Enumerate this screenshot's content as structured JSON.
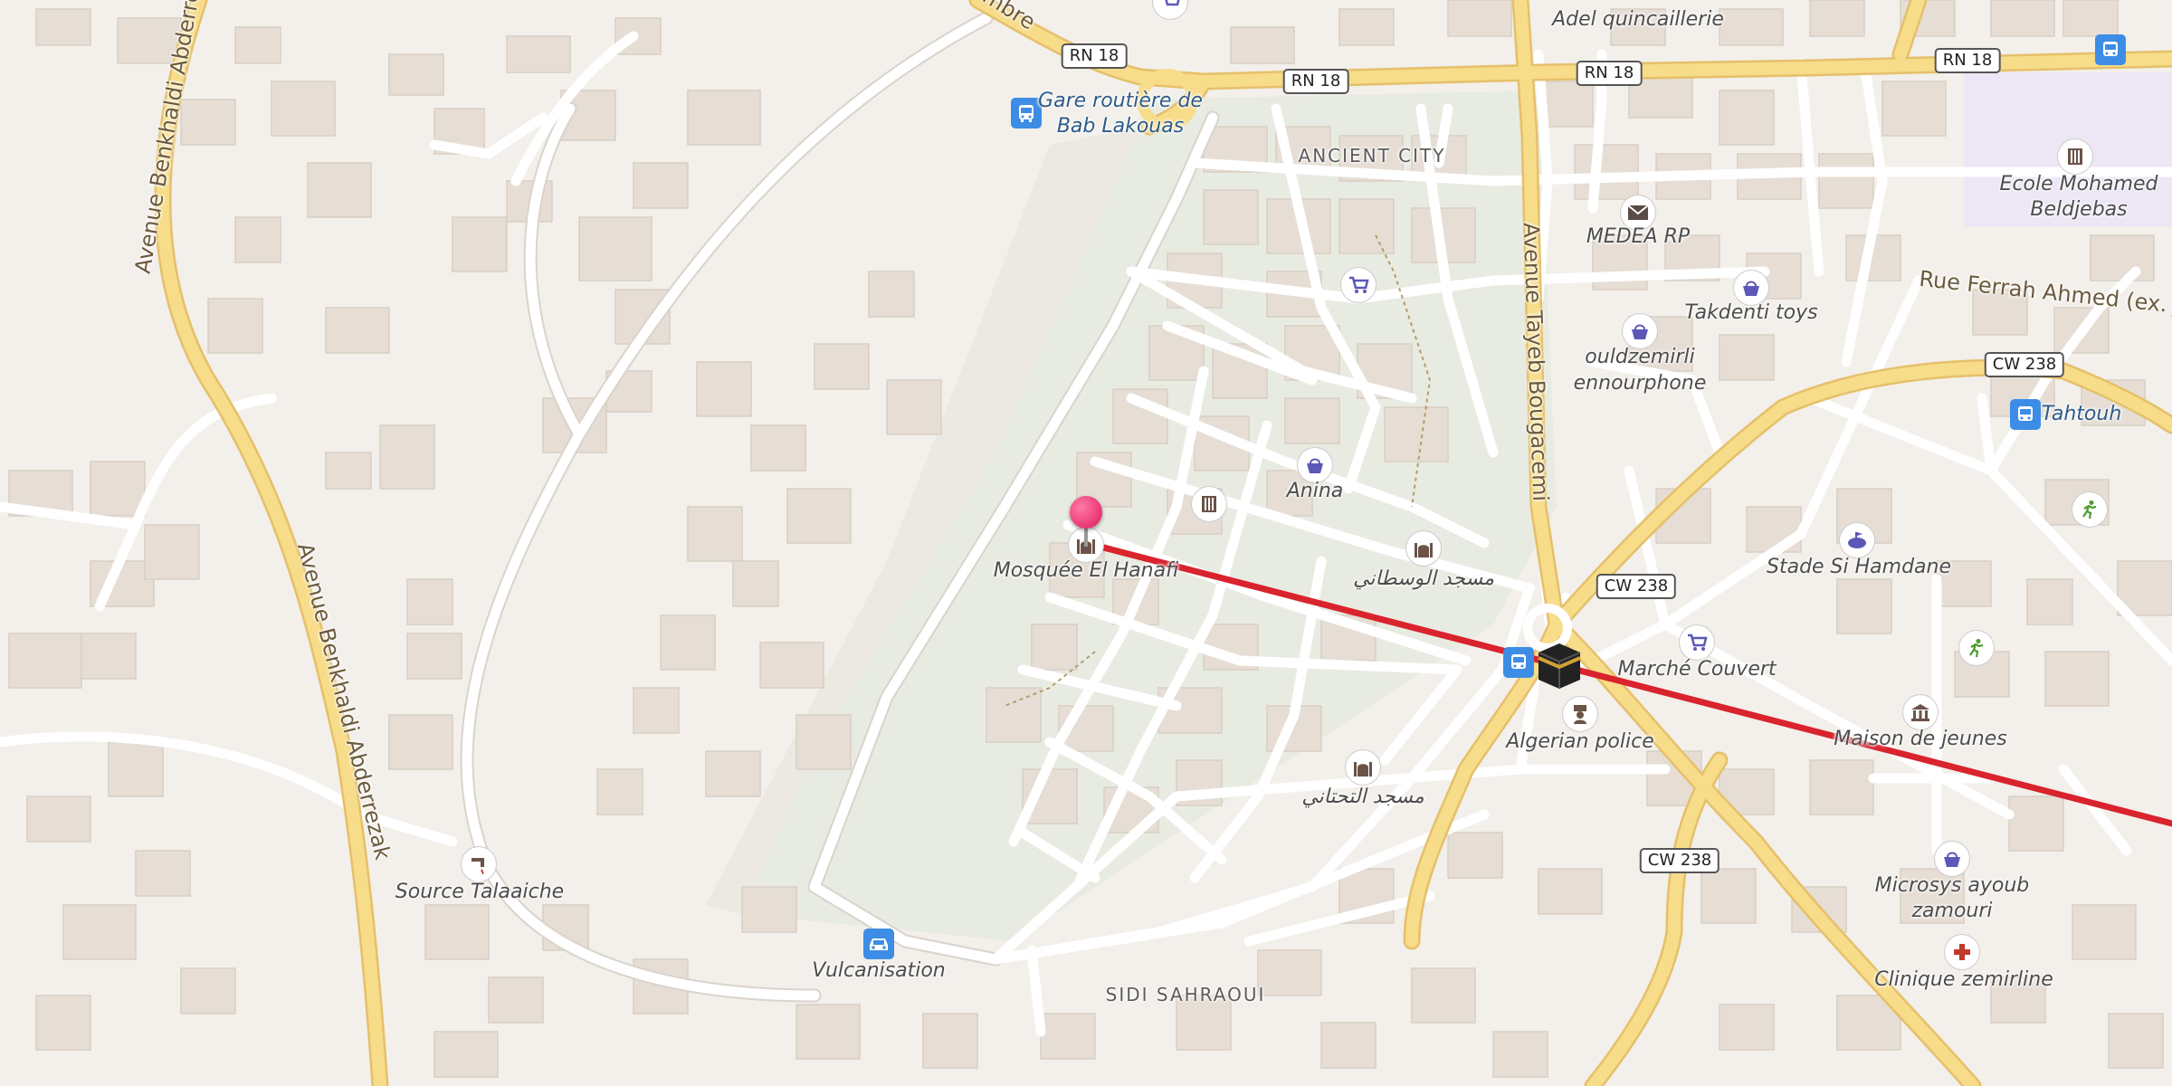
{
  "map": {
    "roads": {
      "rn18": [
        "RN 18",
        "RN 18",
        "RN 18",
        "RN 18"
      ],
      "cw238": [
        "CW 238",
        "CW 238",
        "CW 238"
      ]
    },
    "streets": {
      "benkhaldi_top": "Avenue Benkhaldi Abderre",
      "benkhaldi_bottom": "Avenue Benkhaldi Abderrezak",
      "tayeb": "Avenue Tayeb Bougacemi",
      "ferrah": "Rue Ferrah Ahmed (ex. J",
      "top_fragment": "mbre"
    },
    "districts": {
      "ancient_city": "ANCIENT CITY",
      "sidi_sahraoui": "SIDI SAHRAOUI"
    },
    "places": {
      "gare_line1": "Gare routière de",
      "gare_line2": "Bab Lakouas",
      "adel": "Adel quincaillerie",
      "ecole_line1": "Ecole Mohamed",
      "ecole_line2": "Beldjebas",
      "medea_rp": "MEDEA RP",
      "takdenti": "Takdenti toys",
      "ouldz_line1": "ouldzemirli",
      "ouldz_line2": "ennourphone",
      "tahtouh": "Tahtouh",
      "anina": "Anina",
      "mosquee_hanafi": "Mosquée El Hanafi",
      "masjid_watani": "مسجد الوسطاني",
      "stade": "Stade Si Hamdane",
      "marche": "Marché Couvert",
      "maison": "Maison de jeunes",
      "police": "Algerian police",
      "masjid_tahtani": "مسجد التحتاني",
      "source": "Source Talaaiche",
      "vulcanisation": "Vulcanisation",
      "microsys_line1": "Microsys ayoub",
      "microsys_line2": "zamouri",
      "clinique": "Clinique zemirline"
    },
    "icons": {
      "bus": "bus-stop-icon",
      "car": "car-repair-icon",
      "shop": "shopping-basket-icon",
      "cart": "shopping-cart-icon",
      "mail": "post-office-icon",
      "school": "school-icon",
      "mosque": "mosque-icon",
      "kaaba": "qibla-kaaba-icon",
      "stadium": "stadium-icon",
      "museum": "community-centre-icon",
      "police": "police-icon",
      "spring": "water-source-icon",
      "sport": "sport-icon",
      "hospital": "hospital-icon",
      "pin": "location-pin-icon"
    },
    "colors": {
      "background": "#f3efea",
      "building": "#e6ded5",
      "minor_road": "#ffffff",
      "major_road": "#f7dc8a",
      "major_road_casing": "#e5c06a",
      "qibla_line": "#d9232d",
      "pin": "#e0195b",
      "transit_blue": "#3d8de6",
      "poi_purple": "#5b58b8"
    }
  }
}
